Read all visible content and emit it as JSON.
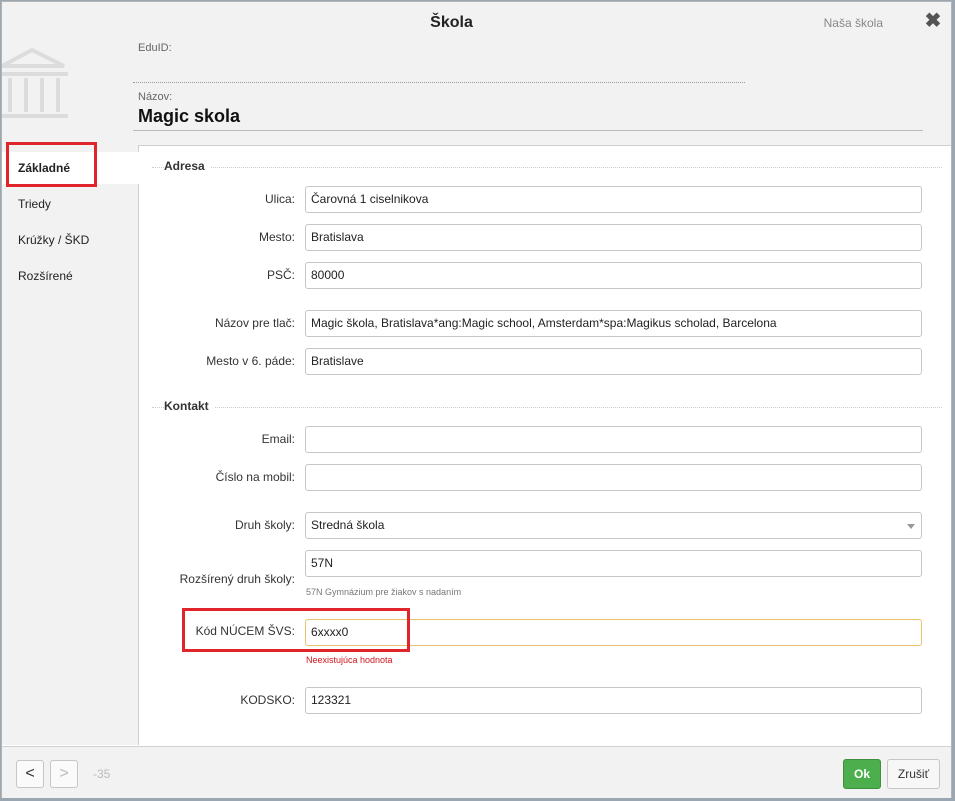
{
  "header": {
    "title": "Škola",
    "subtitle": "Naša škola",
    "close_icon": "close-icon",
    "school_icon": "school-building-icon",
    "eduid_label": "EduID:",
    "eduid_value": "",
    "name_label": "Názov:",
    "name_value": "Magic skola"
  },
  "sidebar": {
    "items": [
      {
        "label": "Základné",
        "active": true
      },
      {
        "label": "Triedy",
        "active": false
      },
      {
        "label": "Krúžky / ŠKD",
        "active": false
      },
      {
        "label": "Rozšírené",
        "active": false
      }
    ]
  },
  "sections": {
    "address": "Adresa",
    "contact": "Kontakt"
  },
  "fields": {
    "street": {
      "label": "Ulica:",
      "value": "Čarovná 1 ciselnikova"
    },
    "city": {
      "label": "Mesto:",
      "value": "Bratislava"
    },
    "zip": {
      "label": "PSČ:",
      "value": "80000"
    },
    "print_name": {
      "label": "Názov pre tlač:",
      "value": "Magic škola, Bratislava*ang:Magic school, Amsterdam*spa:Magikus scholad, Barcelona"
    },
    "city_locative": {
      "label": "Mesto v 6. páde:",
      "value": "Bratislave"
    },
    "email": {
      "label": "Email:",
      "value": ""
    },
    "mobile": {
      "label": "Číslo na mobil:",
      "value": ""
    },
    "school_type": {
      "label": "Druh školy:",
      "value": "Stredná škola"
    },
    "school_type_ext": {
      "label": "Rozšírený druh školy:",
      "value": "57N",
      "hint": "57N Gymnázium pre žiakov s nadaním"
    },
    "nucem_code": {
      "label": "Kód NÚCEM ŠVS:",
      "value": "6xxxx0",
      "error": "Neexistujúca hodnota"
    },
    "kodsko": {
      "label": "KODSKO:",
      "value": "123321"
    }
  },
  "footer": {
    "prev": "<",
    "next": ">",
    "counter": "-35",
    "ok": "Ok",
    "cancel": "Zrušiť"
  },
  "colors": {
    "ok_green": "#4cae4c",
    "highlight_red": "#e0242b",
    "error_red": "#d0141b"
  }
}
